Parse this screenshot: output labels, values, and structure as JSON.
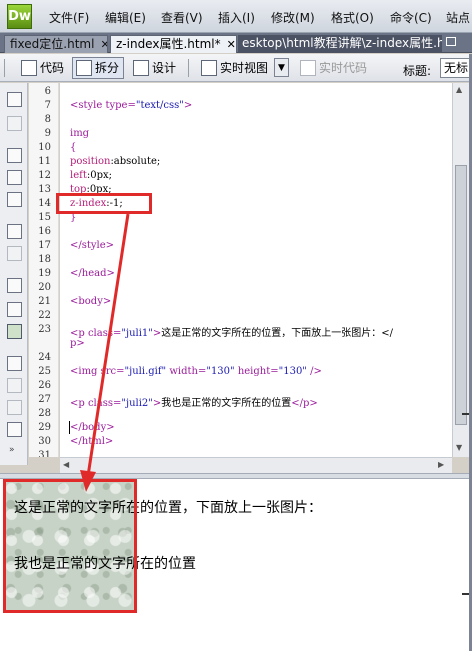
{
  "app": {
    "logo": "Dw"
  },
  "menu": [
    "文件(F)",
    "编辑(E)",
    "查看(V)",
    "插入(I)",
    "修改(M)",
    "格式(O)",
    "命令(C)",
    "站点"
  ],
  "tabs": [
    {
      "label": "fixed定位.html",
      "close": "✕",
      "active": false
    },
    {
      "label": "z-index属性.html*",
      "close": "✕",
      "active": true
    }
  ],
  "file_path": "esktop\\html教程讲解\\z-index属性.html",
  "toolbar": {
    "code": "代码",
    "split": "拆分",
    "design": "设计",
    "live_view": "实时视图",
    "live_code": "实时代码",
    "title_label": "标题:",
    "title_value": "无标"
  },
  "code": {
    "line_numbers": [
      "6",
      "7",
      "8",
      "9",
      "10",
      "11",
      "12",
      "13",
      "14",
      "15",
      "16",
      "17",
      "18",
      "19",
      "20",
      "21",
      "22",
      "23",
      "",
      "24",
      "25",
      "26",
      "27",
      "28",
      "29",
      "30",
      "31"
    ],
    "l7_open": "<style type=",
    "l7_val": "\"text/css\"",
    "l7_close": ">",
    "l9": "img",
    "l10": "{",
    "l11_prop": "position",
    "l11_val": ":absolute;",
    "l12_prop": "left",
    "l12_val": ":0px;",
    "l13_prop": "top",
    "l13_val": ":0px;",
    "l14_prop": "z-index",
    "l14_val": ":-1;",
    "l15": "}",
    "l17": "</style>",
    "l19": "</head>",
    "l21": "<body>",
    "l23_open": "<p class=",
    "l23_val": "\"juli1\"",
    "l23_close": ">",
    "l23_text": "这是正常的文字所在的位置，下面放上一张图片：</",
    "l23_wrap": "p>",
    "l25_open": "<img src=",
    "l25_src": "\"juli.gif\"",
    "l25_w": " width=",
    "l25_wv": "\"130\"",
    "l25_h": " height=",
    "l25_hv": "\"130\"",
    "l25_close": " />",
    "l27_open": "<p class=",
    "l27_val": "\"juli2\"",
    "l27_close": ">",
    "l27_text": "我也是正常的文字所在的位置",
    "l27_end": "</p>",
    "l29": "</body>",
    "l30": "</html>"
  },
  "design_view": {
    "line1": "这是正常的文字所在的位置，下面放上一张图片：",
    "line2": "我也是正常的文字所在的位置"
  },
  "colors": {
    "annotation": "#e02a2a",
    "tag": "#9b1c9b",
    "string": "#1a1ab2"
  }
}
